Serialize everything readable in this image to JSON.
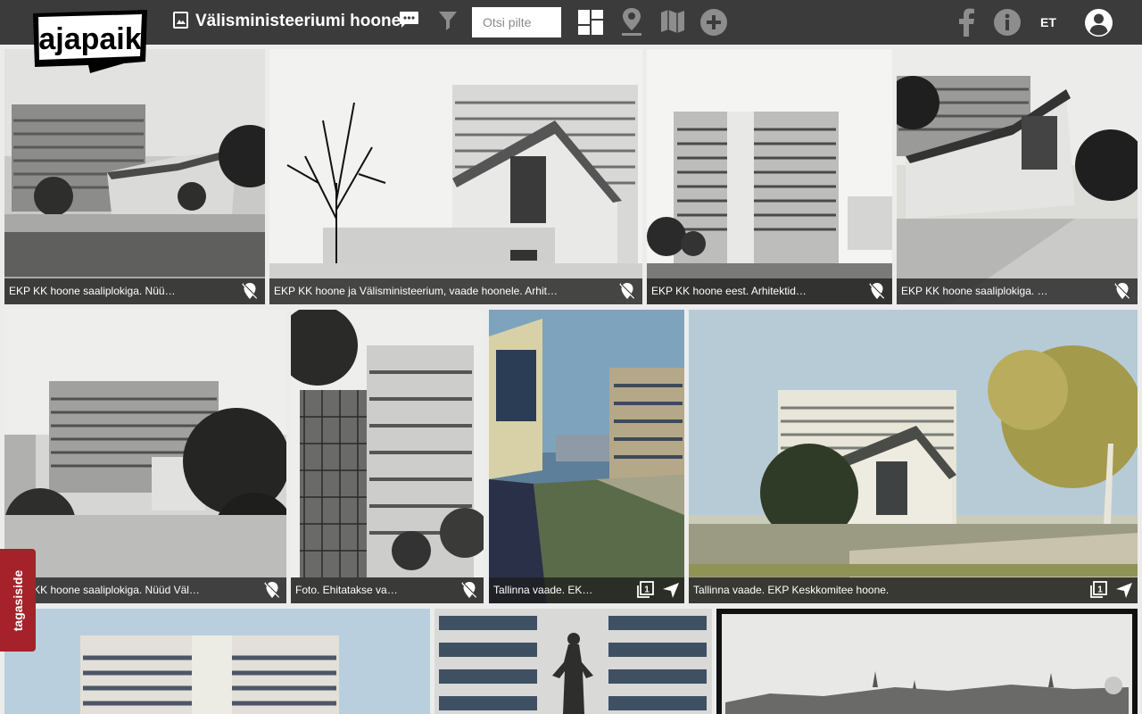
{
  "header": {
    "logo_text": "ajapaik",
    "album_title": "Välisministeeriumi hoone",
    "search_placeholder": "Otsi pilte",
    "language": "ET",
    "icons": [
      "album-icon",
      "chat-icon",
      "filter-icon",
      "gallery-icon",
      "map-pin-icon",
      "map-icon",
      "add-icon",
      "facebook-icon",
      "info-icon",
      "user-icon"
    ]
  },
  "photos": [
    {
      "caption": "EKP KK hoone saaliplokiga. Nüü…",
      "badges": [
        "no-location-icon"
      ]
    },
    {
      "caption": "EKP KK hoone ja Välisministeerium, vaade hoonele. Arhit…",
      "badges": [
        "no-location-icon"
      ]
    },
    {
      "caption": "EKP KK hoone eest. Arhitektid…",
      "badges": [
        "no-location-icon"
      ]
    },
    {
      "caption": "EKP KK hoone saaliplokiga. …",
      "badges": [
        "no-location-icon"
      ]
    },
    {
      "caption": "EKP KK hoone saaliplokiga. Nüüd Väl…",
      "badges": [
        "no-location-icon"
      ]
    },
    {
      "caption": "Foto. Ehitatakse va…",
      "badges": [
        "no-location-icon"
      ]
    },
    {
      "caption": "Tallinna vaade. EK…",
      "badges": [
        "rephoto-count-icon",
        "direction-icon"
      ],
      "rephoto_count": "1"
    },
    {
      "caption": "Tallinna vaade. EKP Keskkomitee hoone.",
      "badges": [
        "rephoto-count-icon",
        "direction-icon"
      ],
      "rephoto_count": "1"
    },
    {
      "caption": "",
      "badges": []
    },
    {
      "caption": "",
      "badges": []
    },
    {
      "caption": "",
      "badges": []
    }
  ],
  "feedback": {
    "label": "tagasiside"
  },
  "colors": {
    "topbar": "#3b3b3b",
    "feedback": "#a5222a",
    "icon_grey": "#8d8d8d"
  }
}
